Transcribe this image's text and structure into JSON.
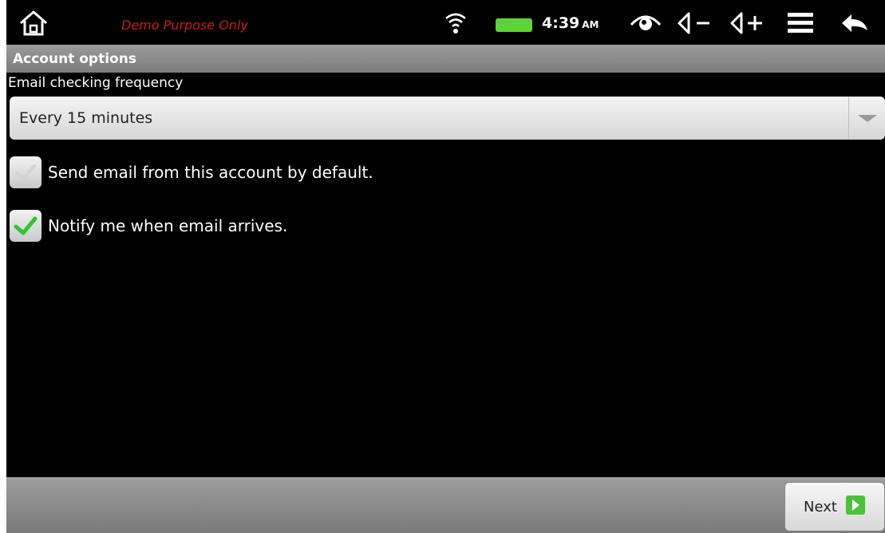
{
  "statusbar": {
    "watermark": "Demo Purpose Only",
    "time": "4:39",
    "ampm": "AM"
  },
  "titlebar": {
    "title": "Account options"
  },
  "frequency": {
    "label": "Email checking frequency",
    "selected": "Every 15 minutes"
  },
  "options": [
    {
      "label": "Send email from this account by default.",
      "checked": false
    },
    {
      "label": "Notify me when email arrives.",
      "checked": true
    }
  ],
  "footer": {
    "next_label": "Next"
  },
  "colors": {
    "watermark": "#cc1a1a",
    "battery": "#5fd13a",
    "check": "#33c233",
    "next_arrow": "#4cc23a"
  }
}
